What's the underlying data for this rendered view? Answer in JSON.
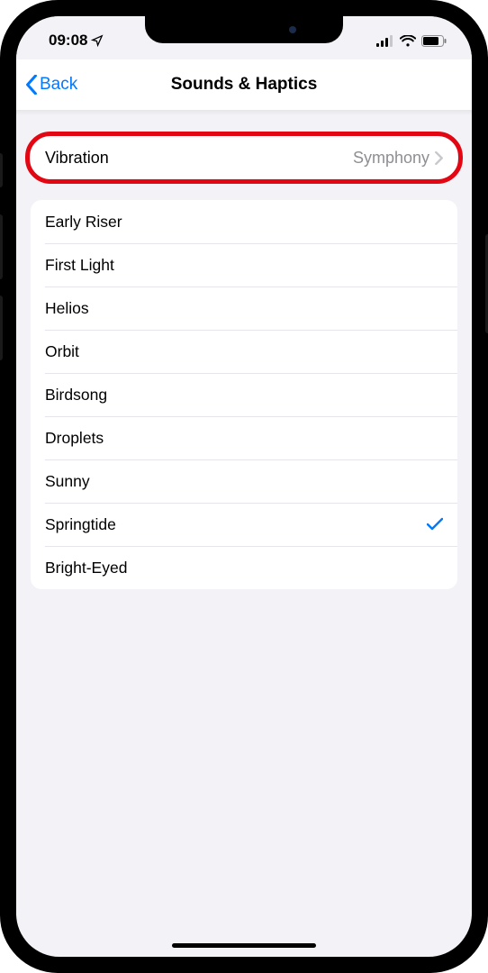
{
  "status": {
    "time": "09:08"
  },
  "nav": {
    "back_label": "Back",
    "title": "Sounds & Haptics"
  },
  "vibration_row": {
    "label": "Vibration",
    "value": "Symphony"
  },
  "sounds": [
    {
      "label": "Early Riser",
      "selected": false
    },
    {
      "label": "First Light",
      "selected": false
    },
    {
      "label": "Helios",
      "selected": false
    },
    {
      "label": "Orbit",
      "selected": false
    },
    {
      "label": "Birdsong",
      "selected": false
    },
    {
      "label": "Droplets",
      "selected": false
    },
    {
      "label": "Sunny",
      "selected": false
    },
    {
      "label": "Springtide",
      "selected": true
    },
    {
      "label": "Bright-Eyed",
      "selected": false
    }
  ],
  "colors": {
    "accent": "#007aff",
    "highlight": "#e30613",
    "secondary_text": "#8e8e93",
    "background": "#f2f2f7"
  }
}
